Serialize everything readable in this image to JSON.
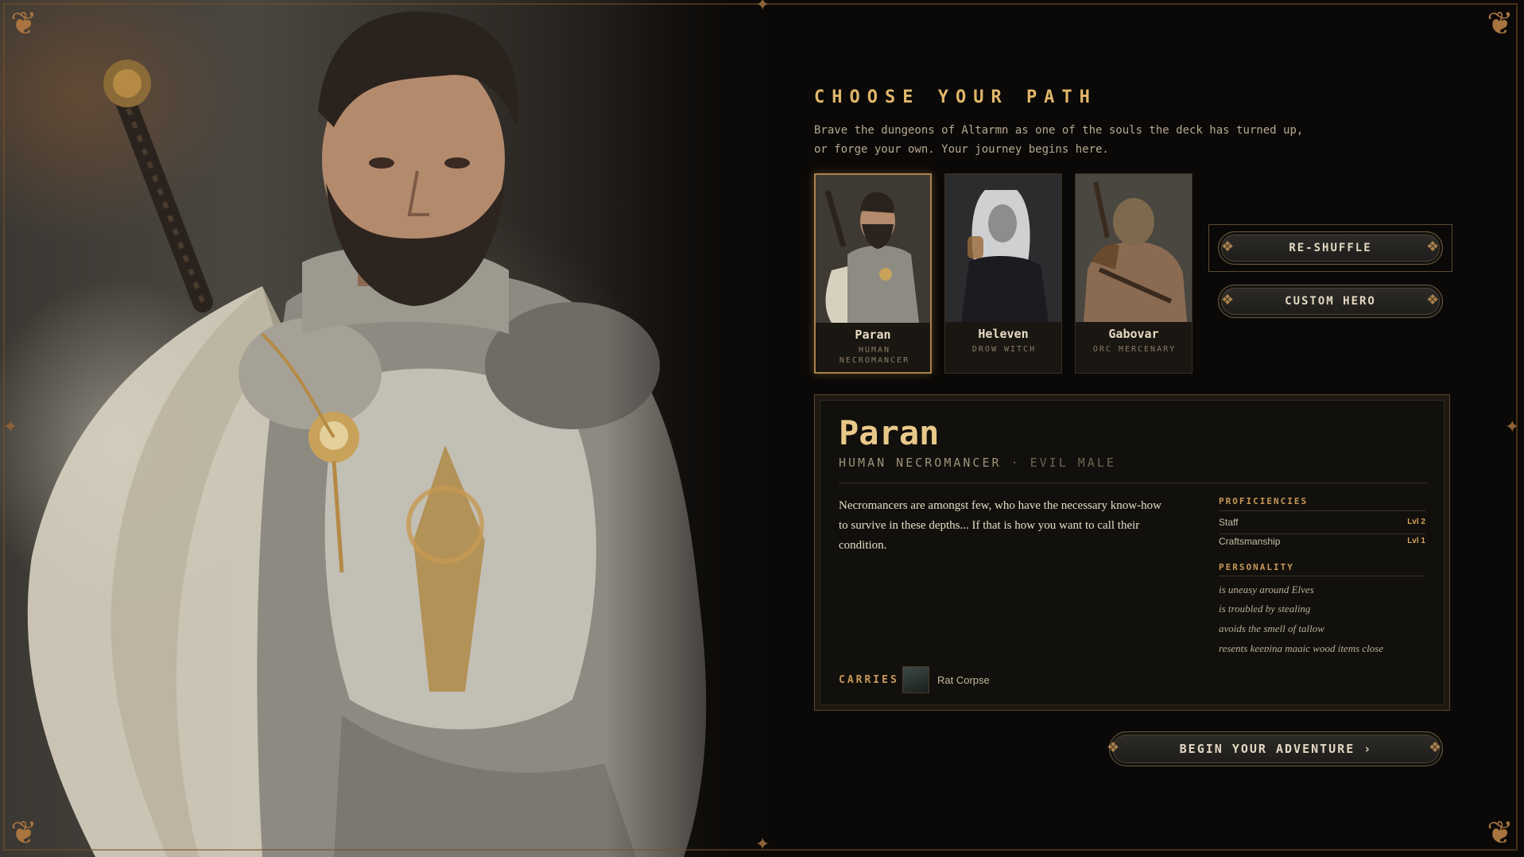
{
  "header": {
    "title": "CHOOSE YOUR PATH",
    "subtitle": "Brave the dungeons of Altarmn as one of the souls the deck has turned up, or forge your own. Your journey begins here."
  },
  "heroes": [
    {
      "name": "Paran",
      "class": "HUMAN NECROMANCER",
      "selected": true
    },
    {
      "name": "Heleven",
      "class": "DROW WITCH",
      "selected": false
    },
    {
      "name": "Gabovar",
      "class": "ORC MERCENARY",
      "selected": false
    }
  ],
  "actions": {
    "reshuffle_label": "RE-SHUFFLE",
    "custom_hero_label": "CUSTOM HERO",
    "begin_label": "BEGIN YOUR ADVENTURE ›"
  },
  "details": {
    "name": "Paran",
    "class_line": "HUMAN NECROMANCER",
    "separator": "·",
    "alignment": "EVIL MALE",
    "description": "Necromancers are amongst few, who have the necessary know-how to survive in these depths... If that is how you want to call their condition.",
    "proficiencies_heading": "PROFICIENCIES",
    "proficiencies": [
      {
        "name": "Staff",
        "level": "Lvl 2"
      },
      {
        "name": "Craftsmanship",
        "level": "Lvl 1"
      }
    ],
    "personality_heading": "PERSONALITY",
    "personality": [
      "is uneasy around Elves",
      "is troubled by stealing",
      "avoids the smell of tallow",
      "resents keeping magic wood items close"
    ],
    "carries_label": "CARRIES",
    "carries_item": "Rat Corpse"
  },
  "colors": {
    "accent_gold": "#e0b66a",
    "panel_bg": "#0b0907",
    "frame_bronze": "#a9743f"
  },
  "icons": [
    "knight-portrait",
    "rat-corpse-icon",
    "corner-ornament-icon",
    "chevron-right-icon"
  ]
}
